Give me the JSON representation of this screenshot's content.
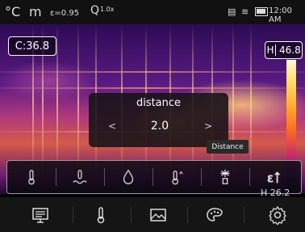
{
  "status_bar": {
    "unit": "°C",
    "mode_icon": "m",
    "emissivity": "ε=0.95",
    "zoom": "1.0x",
    "time": "12:00 AM"
  },
  "center_temp": "C:36.8",
  "high_label": "H",
  "high_value": "46.8",
  "dialog": {
    "title": "distance",
    "value": "2.0",
    "left_arrow": "<",
    "right_arrow": ">"
  },
  "tooltip": "Distance",
  "toolbar": {
    "items": [
      {
        "name": "thermometer-icon"
      },
      {
        "name": "humidity-icon"
      },
      {
        "name": "drop-icon"
      },
      {
        "name": "temperature-up-icon"
      },
      {
        "name": "distance-icon"
      },
      {
        "name": "emissivity-icon"
      }
    ]
  },
  "low_value_partial": "H 26.2",
  "bottom_menu": {
    "items": [
      {
        "name": "display-icon"
      },
      {
        "name": "thermometer-icon"
      },
      {
        "name": "image-icon"
      },
      {
        "name": "palette-icon"
      },
      {
        "name": "settings-icon"
      }
    ]
  },
  "colors": {
    "scale_top": "#fffbe0",
    "scale_bottom": "#1a0840",
    "toolbar_border": "#9a9a9a"
  }
}
